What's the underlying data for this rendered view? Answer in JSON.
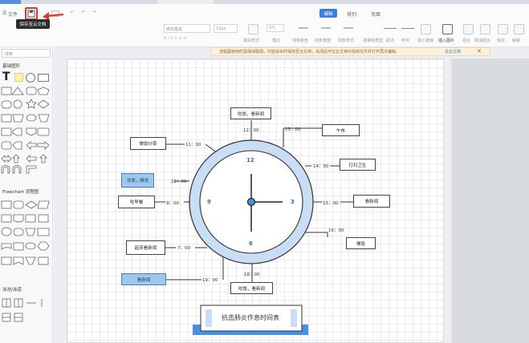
{
  "toolbar": {
    "file_label": "文件",
    "tooltip": "保存至云文档",
    "tabs": [
      "编辑",
      "排列",
      "页面"
    ],
    "font_name": "微软雅黑",
    "font_size": "12px",
    "percent_value": "0%",
    "group1": [
      "填充样式",
      "描边",
      "线条颜色",
      "线条宽度",
      "线条样式"
    ],
    "group2": [
      "连接线类型",
      "起点",
      "终点"
    ],
    "group3": [
      "插入链接",
      "插入图片",
      "组合",
      "取消组合",
      "锁定",
      "解锁"
    ]
  },
  "banner": {
    "text": "流程图使用时需保持联网，内容会实时保存至云文档，关闭后可在云文档中找到文件并打开再次编辑。",
    "link": "去云文档"
  },
  "sidebar": {
    "search_placeholder": "搜索",
    "section_basic": "基础图形",
    "text_tool": "T",
    "section_flowchart": "Flowchart 流程图",
    "section_swimlane": "泳池/泳道"
  },
  "clock": {
    "numerals": [
      "12",
      "3",
      "6",
      "9"
    ],
    "times": {
      "t12": "12：00",
      "t13": "13：00",
      "t11": "11：00",
      "t14": "14：00",
      "t22": "22：00",
      "t9": "9：00",
      "t15": "15：00",
      "t16": "16：00",
      "t7": "7：00",
      "t19": "19：00",
      "t18": "18：00"
    },
    "activities": {
      "a12": "吃饭，看新闻",
      "a13": "午休",
      "a11": "做饭炒菜",
      "a14": "打扫卫生",
      "a22": "洗漱，睡觉",
      "a9": "吃早餐",
      "a15": "看新闻",
      "a16": "做饭",
      "a7": "起床看新闻",
      "a19": "看新闻",
      "a18": "吃饭，看新闻"
    }
  },
  "title": "抗击肺炎作息时间表",
  "colors": {
    "accent": "#4a90e2",
    "clock_ring": "#c9ddf5",
    "highlight_box": "#9fc6ec",
    "arrow": "#e8332b"
  }
}
